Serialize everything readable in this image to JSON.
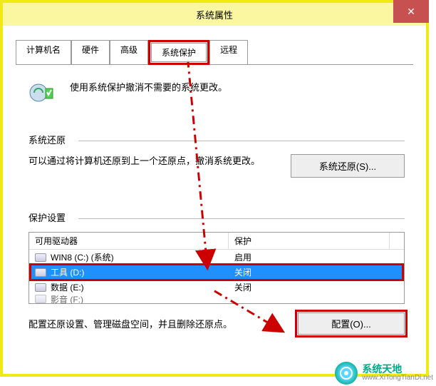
{
  "window": {
    "title": "系统属性",
    "close_icon": "✕"
  },
  "tabs": {
    "computer_name": "计算机名",
    "hardware": "硬件",
    "advanced": "高级",
    "system_protection": "系统保护",
    "remote": "远程"
  },
  "intro": {
    "text": "使用系统保护撤消不需要的系统更改。"
  },
  "restore_group": {
    "label": "系统还原",
    "text": "可以通过将计算机还原到上一个还原点，撤消系统更改。",
    "button": "系统还原(S)..."
  },
  "protection_group": {
    "label": "保护设置",
    "header_drive": "可用驱动器",
    "header_protection": "保护",
    "drives": [
      {
        "name": "WIN8 (C:) (系统)",
        "status": "启用"
      },
      {
        "name": "工具 (D:)",
        "status": "关闭"
      },
      {
        "name": "数据 (E:)",
        "status": "关闭"
      },
      {
        "name": "影音 (F:)",
        "status": ""
      }
    ],
    "selected_index": 1
  },
  "config": {
    "text": "配置还原设置、管理磁盘空间，并且删除还原点。",
    "button": "配置(O)..."
  },
  "watermark": {
    "cn": "系统天地",
    "en": "www.XiTongTianDi.net"
  }
}
